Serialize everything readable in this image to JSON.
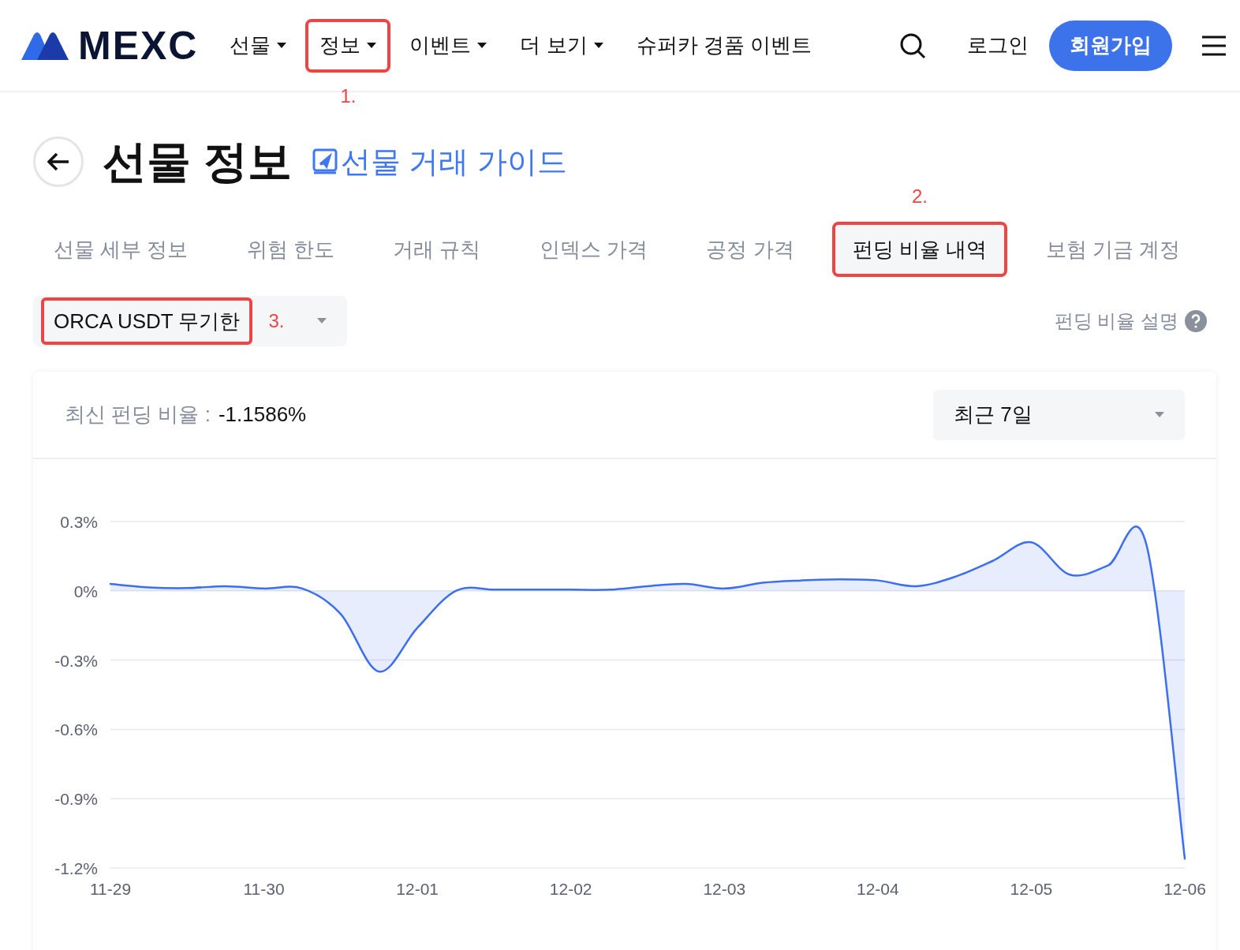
{
  "header": {
    "logo": "MEXC",
    "nav": [
      {
        "label": "선물",
        "dropdown": true,
        "highlighted": false
      },
      {
        "label": "정보",
        "dropdown": true,
        "highlighted": true,
        "annotation": "1."
      },
      {
        "label": "이벤트",
        "dropdown": true,
        "highlighted": false
      },
      {
        "label": "더 보기",
        "dropdown": true,
        "highlighted": false
      },
      {
        "label": "슈퍼카 경품 이벤트",
        "dropdown": false,
        "highlighted": false
      }
    ],
    "login": "로그인",
    "signup": "회원가입"
  },
  "page": {
    "title": "선물 정보",
    "guide_link": "선물 거래 가이드"
  },
  "tabs": [
    {
      "label": "선물 세부 정보",
      "selected": false,
      "highlighted": false
    },
    {
      "label": "위험 한도",
      "selected": false,
      "highlighted": false
    },
    {
      "label": "거래 규칙",
      "selected": false,
      "highlighted": false
    },
    {
      "label": "인덱스 가격",
      "selected": false,
      "highlighted": false
    },
    {
      "label": "공정 가격",
      "selected": false,
      "highlighted": false
    },
    {
      "label": "펀딩 비율 내역",
      "selected": true,
      "highlighted": true,
      "annotation": "2."
    },
    {
      "label": "보험 기금 계정",
      "selected": false,
      "highlighted": false
    }
  ],
  "contract_select": {
    "value": "ORCA USDT 무기한",
    "highlighted": true,
    "annotation": "3."
  },
  "funding_help": "펀딩 비율 설명",
  "card": {
    "latest_label": "최신 펀딩 비율 :",
    "latest_value": "-1.1586%",
    "period": "최근 7일",
    "chart_data": {
      "type": "area",
      "categories": [
        "11-29",
        null,
        null,
        null,
        "11-30",
        null,
        null,
        null,
        "12-01",
        null,
        null,
        null,
        "12-02",
        null,
        null,
        null,
        "12-03",
        null,
        null,
        null,
        "12-04",
        null,
        null,
        null,
        "12-05",
        null,
        null,
        null,
        "12-06"
      ],
      "series": [
        {
          "color": "#3b6ef0",
          "values": [
            0.03,
            0.015,
            0.012,
            0.02,
            0.01,
            0.01,
            -0.1,
            -0.35,
            -0.16,
            0.0,
            0.005,
            0.005,
            0.005,
            0.005,
            0.02,
            0.03,
            0.01,
            0.035,
            0.045,
            0.05,
            0.045,
            0.02,
            0.06,
            0.13,
            0.21,
            0.07,
            0.11,
            0.2,
            -1.16
          ]
        }
      ],
      "ylim": [
        -1.2,
        0.3
      ],
      "grid": true,
      "yticks": [
        {
          "value": 0.3,
          "label": "0.3%"
        },
        {
          "value": 0,
          "label": "0%"
        },
        {
          "value": -0.3,
          "label": "-0.3%"
        },
        {
          "value": -0.6,
          "label": "-0.6%"
        },
        {
          "value": -0.9,
          "label": "-0.9%"
        },
        {
          "value": -1.2,
          "label": "-1.2%"
        }
      ]
    }
  }
}
